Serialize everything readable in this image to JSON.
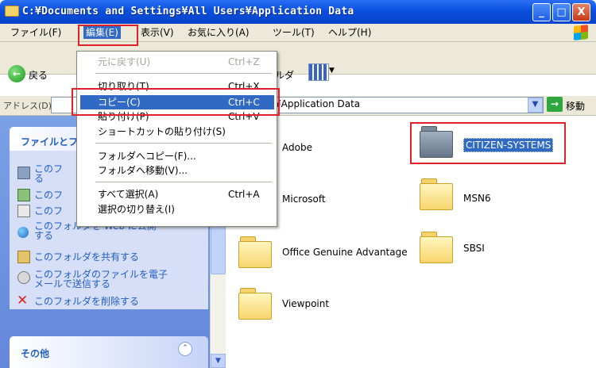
{
  "window": {
    "title": "C:¥Documents and Settings¥All Users¥Application Data",
    "buttons": {
      "minimize": "_",
      "maximize": "□",
      "close": "X"
    }
  },
  "menubar": {
    "items": [
      "ファイル(F)",
      "編集(E)",
      "表示(V)",
      "お気に入り(A)",
      "ツール(T)",
      "ヘルプ(H)"
    ]
  },
  "toolbar": {
    "back": "戻る",
    "partial_label": "ルダ"
  },
  "address": {
    "label": "アドレス(D)",
    "value": "¥Application Data",
    "go": "移動"
  },
  "edit_menu": {
    "items": [
      {
        "label": "元に戻す(U)",
        "shortcut": "Ctrl+Z",
        "state": "disabled"
      },
      {
        "label": "切り取り(T)",
        "shortcut": "Ctrl+X",
        "state": "normal"
      },
      {
        "label": "コピー(C)",
        "shortcut": "Ctrl+C",
        "state": "highlighted"
      },
      {
        "label": "貼り付け(P)",
        "shortcut": "Ctrl+V",
        "state": "normal"
      },
      {
        "label": "ショートカットの貼り付け(S)",
        "shortcut": "",
        "state": "normal"
      },
      {
        "label": "フォルダへコピー(F)...",
        "shortcut": "",
        "state": "normal"
      },
      {
        "label": "フォルダへ移動(V)...",
        "shortcut": "",
        "state": "normal"
      },
      {
        "label": "すべて選択(A)",
        "shortcut": "Ctrl+A",
        "state": "normal"
      },
      {
        "label": "選択の切り替え(I)",
        "shortcut": "",
        "state": "normal"
      }
    ]
  },
  "task_pane": {
    "file_tasks_title": "ファイルとフ",
    "file_tasks": [
      {
        "icon": "rename-icon",
        "text_lines": [
          "このフ",
          "る"
        ]
      },
      {
        "icon": "move-icon",
        "text_lines": [
          "このフ"
        ]
      },
      {
        "icon": "copy-icon",
        "text_lines": [
          "このフ"
        ]
      },
      {
        "icon": "web-publish-icon",
        "text_lines": [
          "このフォルダを Web に公開",
          "する"
        ]
      },
      {
        "icon": "share-icon",
        "text_lines": [
          "このフォルダを共有する"
        ]
      },
      {
        "icon": "email-icon",
        "text_lines": [
          "このフォルダのファイルを電子",
          "メールで送信する"
        ]
      },
      {
        "icon": "delete-icon",
        "text_lines": [
          "このフォルダを削除する"
        ]
      }
    ],
    "other_title": "その他"
  },
  "folders": [
    {
      "name": "Adobe",
      "selected": false
    },
    {
      "name": "CITIZEN-SYSTEMS",
      "selected": true
    },
    {
      "name": "Microsoft",
      "selected": false
    },
    {
      "name": "MSN6",
      "selected": false
    },
    {
      "name": "Office Genuine Advantage",
      "selected": false
    },
    {
      "name": "SBSI",
      "selected": false
    },
    {
      "name": "Viewpoint",
      "selected": false
    }
  ],
  "colors": {
    "titlebar": "#0a4fdc",
    "menu_highlight": "#316ac5",
    "annotation": "#e0202a",
    "task_link": "#215dc6"
  }
}
